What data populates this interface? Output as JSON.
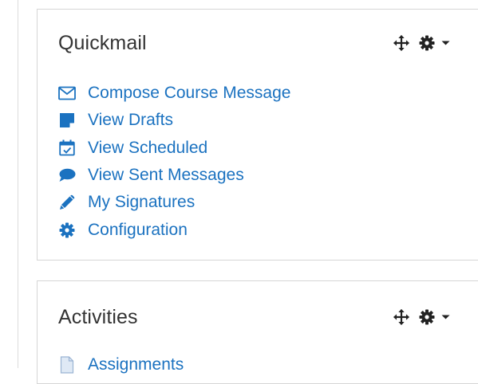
{
  "colors": {
    "link": "#1b72c0",
    "title": "#333333",
    "icon_dark": "#222222",
    "card_border": "#d6d6d6"
  },
  "quickmail": {
    "title": "Quickmail",
    "controls": {
      "move_icon": "move-icon",
      "gear_icon": "gear-icon",
      "caret_icon": "caret-down-icon"
    },
    "items": [
      {
        "label": "Compose Course Message",
        "icon": "envelope-icon"
      },
      {
        "label": "View Drafts",
        "icon": "note-icon"
      },
      {
        "label": "View Scheduled",
        "icon": "calendar-check-icon"
      },
      {
        "label": "View Sent Messages",
        "icon": "comment-icon"
      },
      {
        "label": "My Signatures",
        "icon": "pencil-icon"
      },
      {
        "label": "Configuration",
        "icon": "cog-icon"
      }
    ]
  },
  "activities": {
    "title": "Activities",
    "controls": {
      "move_icon": "move-icon",
      "gear_icon": "gear-icon",
      "caret_icon": "caret-down-icon"
    },
    "items": [
      {
        "label": "Assignments",
        "icon": "file-icon"
      }
    ]
  }
}
